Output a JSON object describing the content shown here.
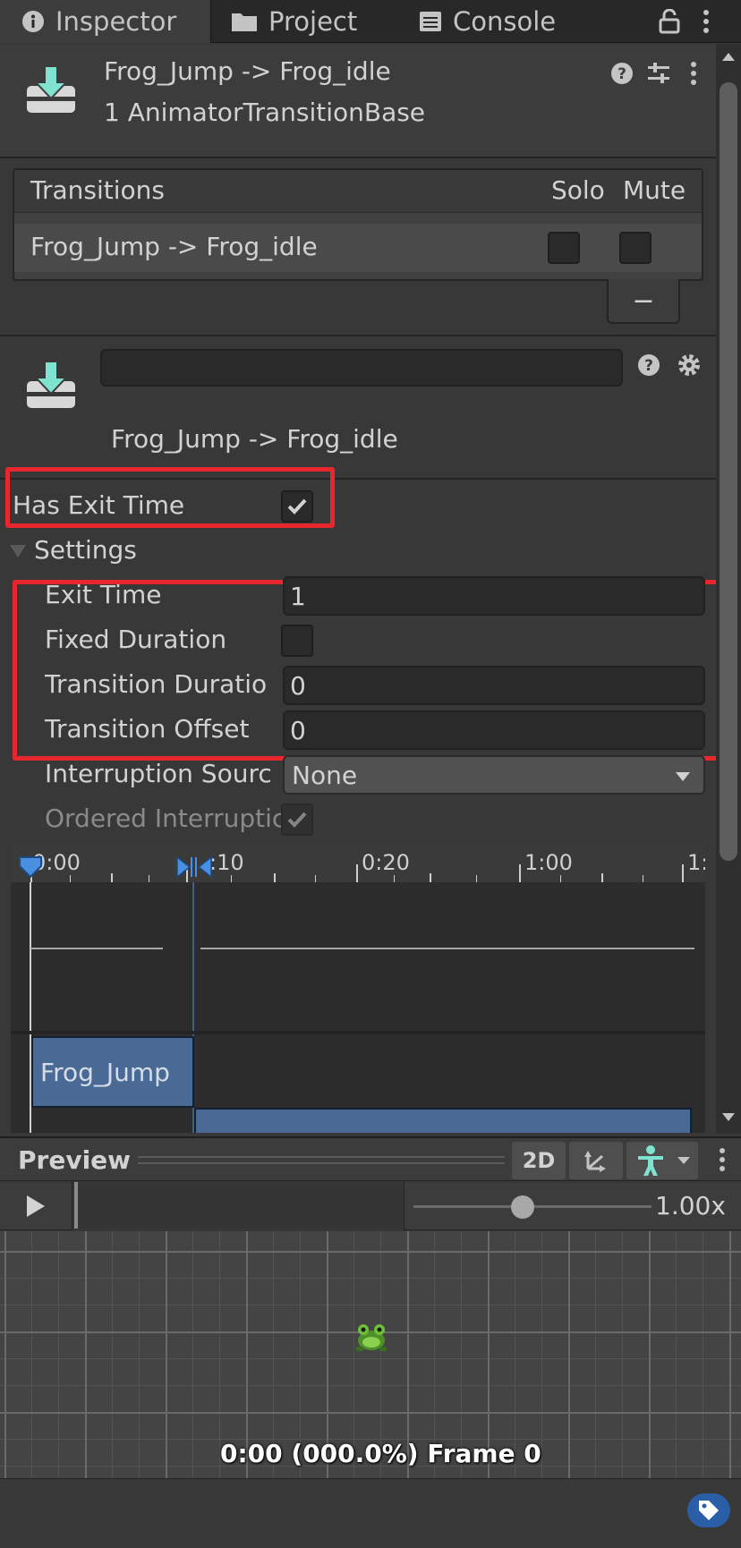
{
  "tabs": [
    {
      "label": "Inspector",
      "icon": "info-icon",
      "active": true
    },
    {
      "label": "Project",
      "icon": "folder-icon",
      "active": false
    },
    {
      "label": "Console",
      "icon": "console-icon",
      "active": false
    }
  ],
  "header": {
    "title": "Frog_Jump -> Frog_idle",
    "subtitle": "1 AnimatorTransitionBase"
  },
  "transitions": {
    "heading": "Transitions",
    "solo_label": "Solo",
    "mute_label": "Mute",
    "rows": [
      {
        "name": "Frog_Jump -> Frog_idle",
        "solo": false,
        "mute": false
      }
    ],
    "remove_label": "−"
  },
  "transition": {
    "name_value": "",
    "caption": "Frog_Jump -> Frog_idle",
    "has_exit_time_label": "Has Exit Time",
    "has_exit_time": true,
    "settings_label": "Settings",
    "exit_time_label": "Exit Time",
    "exit_time": "1",
    "fixed_duration_label": "Fixed Duration",
    "fixed_duration": false,
    "transition_duration_label": "Transition Duratio",
    "transition_duration": "0",
    "transition_offset_label": "Transition Offset",
    "transition_offset": "0",
    "interruption_source_label": "Interruption Sourc",
    "interruption_source": "None",
    "ordered_interruption_label": "Ordered Interruptic",
    "ordered_interruption": true
  },
  "timeline": {
    "ticks": [
      "0:00",
      ":10",
      "0:20",
      "1:00",
      "1:"
    ],
    "source_clip": "Frog_Jump"
  },
  "preview": {
    "title": "Preview",
    "mode_2d": "2D",
    "speed": "1.00x",
    "frame_info": "0:00 (000.0%) Frame 0",
    "speed_fraction": 0.46
  },
  "colors": {
    "accent_red": "#e8262d",
    "transition_icon": "#7fe3cf",
    "clip_blue": "#4a6a96"
  }
}
